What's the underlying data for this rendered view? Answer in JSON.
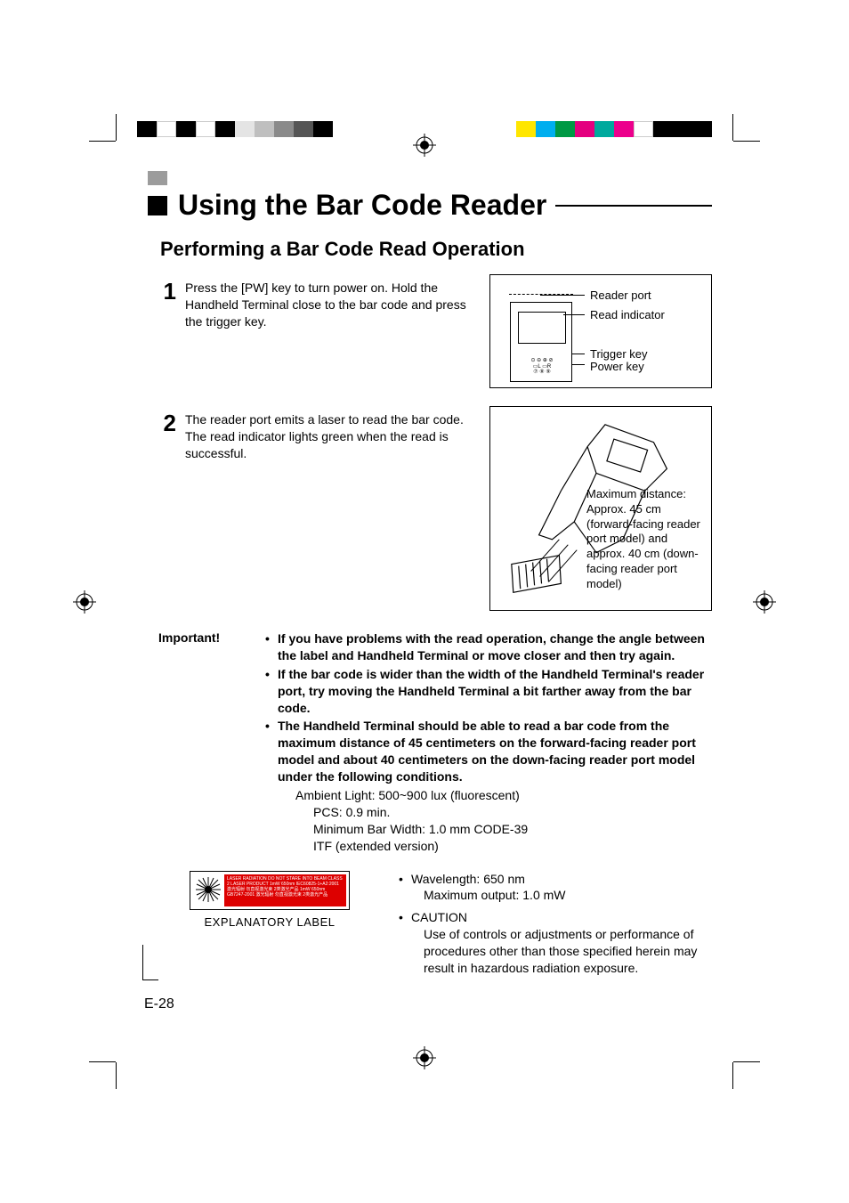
{
  "heading": {
    "title": "Using the Bar Code Reader",
    "subheading": "Performing a Bar Code Read Operation"
  },
  "steps": [
    {
      "num": "1",
      "text": "Press the [PW] key to turn power on. Hold the Handheld Terminal close to the bar code and press the trigger key.",
      "figure": {
        "labels": {
          "reader_port": "Reader port",
          "read_indicator": "Read indicator",
          "trigger_key": "Trigger key",
          "power_key": "Power key"
        }
      }
    },
    {
      "num": "2",
      "text": "The reader port emits a laser to read the bar code. The read indicator lights green when the read is successful.",
      "figure": {
        "caption": "Maximum distance: Approx. 45 cm (forward-facing reader port model) and approx. 40 cm (down-facing reader port model)"
      }
    }
  ],
  "important": {
    "label": "Important!",
    "bullets": [
      "If you have problems with the read operation, change the angle between the label and Handheld Terminal or move closer and then try again.",
      "If the bar code is wider than the width of the Handheld Terminal's reader port, try moving the Handheld Terminal a bit farther away from the bar code.",
      "The Handheld Terminal should be able to read a bar code from the maximum distance of 45 centimeters on the forward-facing reader port model and about 40 centimeters on the down-facing reader port model under the following conditions."
    ],
    "conditions": {
      "line1": "Ambient Light: 500~900 lux (fluorescent)",
      "line2": "PCS: 0.9 min.",
      "line3": "Minimum Bar Width: 1.0 mm CODE-39",
      "line4": "ITF (extended version)"
    }
  },
  "label_figure": {
    "caption": "EXPLANATORY LABEL",
    "text": "LASER RADIATION  DO NOT STARE INTO BEAM\nCLASS 2 LASER PRODUCT  1mW 650nm  IEC60825-1+A2:2001\n激光辐射 勿直视激光束 2类激光产品\n1mW 650nm GB7247-2001\n激光辐射 勿直视激光束 2类激光产品"
  },
  "right_notes": {
    "wavelength_line1": "Wavelength: 650 nm",
    "wavelength_line2": "Maximum output: 1.0 mW",
    "caution_title": "CAUTION",
    "caution_body": "Use of controls or adjustments or performance of procedures other than those specified herein may result in hazardous radiation exposure."
  },
  "page_number": "E-28",
  "colors": {
    "strip_left": [
      "#000",
      "#fff",
      "#000",
      "#fff",
      "#000",
      "#e4e4e4",
      "#bfbfbf",
      "#8a8a8a",
      "#fff"
    ],
    "strip_right": [
      "#ffe600",
      "#00aeef",
      "#009944",
      "#e4007f",
      "#00a99d",
      "#ec008c",
      "#fff",
      "#000"
    ]
  }
}
